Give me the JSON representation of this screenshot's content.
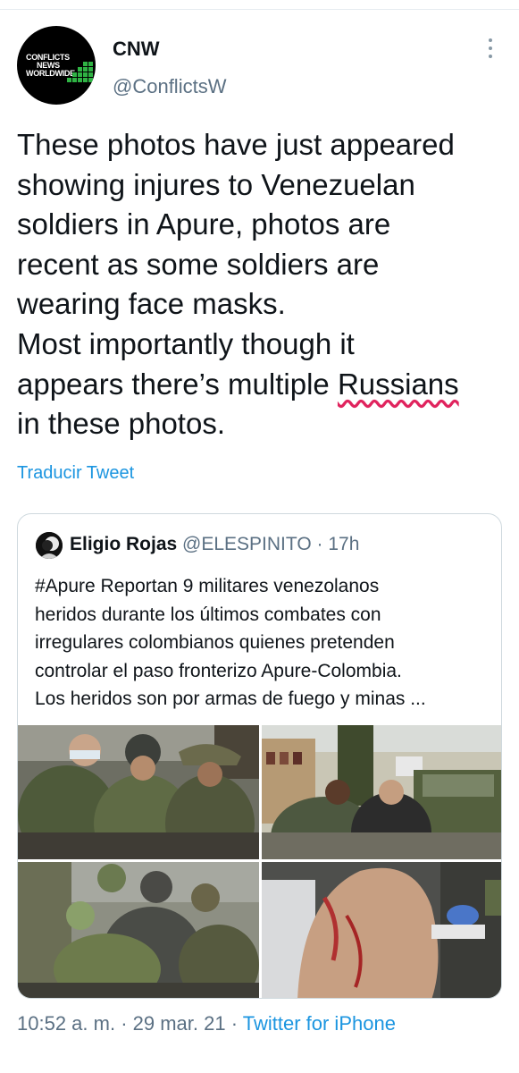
{
  "author": {
    "display_name": "CNW",
    "handle": "@ConflictsW",
    "avatar_logo_lines": [
      "CONFLICTS",
      "NEWS",
      "WORLDWIDE"
    ]
  },
  "tweet": {
    "lines": [
      "These photos have just appeared",
      "showing injures to Venezuelan",
      "soldiers in Apure, photos are",
      "recent as some soldiers are",
      "wearing face masks.",
      "Most importantly though it"
    ],
    "line7_before": "appears there’s multiple ",
    "line7_flagged_word": "Russians",
    "line8": "in these photos."
  },
  "translate_label": "Traducir Tweet",
  "quoted_tweet": {
    "author_name": "Eligio Rojas",
    "author_handle": "@ELESPINITO",
    "separator": " · ",
    "time_ago": "17h",
    "lines": [
      "#Apure Reportan 9 militares venezolanos",
      "heridos durante los últimos combates con",
      "irregulares colombianos quienes pretenden",
      "controlar el paso fronterizo Apure-Colombia.",
      "Los heridos son por armas de fuego y minas ..."
    ],
    "photo_count": 4
  },
  "meta": {
    "time": "10:52 a. m.",
    "separator": " · ",
    "date": "29 mar. 21",
    "source": "Twitter for iPhone"
  },
  "colors": {
    "text": "#0f1419",
    "secondary": "#5b7083",
    "link": "#1b95e0",
    "spellcheck": "#e0245e",
    "border": "#cfd9de",
    "logo_green": "#2fb344"
  }
}
